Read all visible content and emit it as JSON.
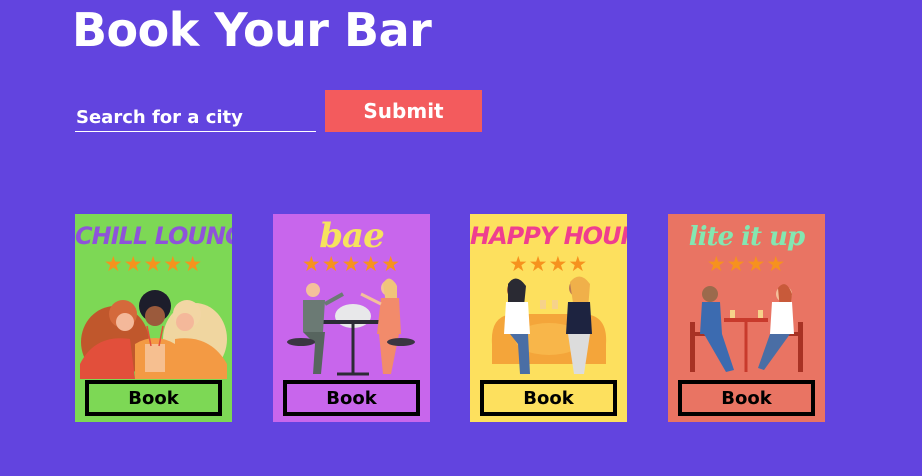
{
  "header": {
    "title": "Book Your Bar"
  },
  "search": {
    "placeholder": "Search for a city",
    "value": "",
    "submit_label": "Submit"
  },
  "bars": [
    {
      "name": "CHILL LOUNGE",
      "stars": "★★★★★",
      "book_label": "Book",
      "bg": "#7dd855",
      "name_color": "#8e53d9"
    },
    {
      "name": "bae",
      "stars": "★★★★★",
      "book_label": "Book",
      "bg": "#c866ec",
      "name_color": "#f6e35e"
    },
    {
      "name": "HAPPY HOUR",
      "stars": "★★★★",
      "book_label": "Book",
      "bg": "#fde05e",
      "name_color": "#ef3e8f"
    },
    {
      "name": "lite it up",
      "stars": "★★★★",
      "book_label": "Book",
      "bg": "#e97463",
      "name_color": "#84e7b1"
    }
  ],
  "colors": {
    "page_bg": "#6244df",
    "submit_bg": "#f35b5d",
    "star": "#f6921e"
  }
}
